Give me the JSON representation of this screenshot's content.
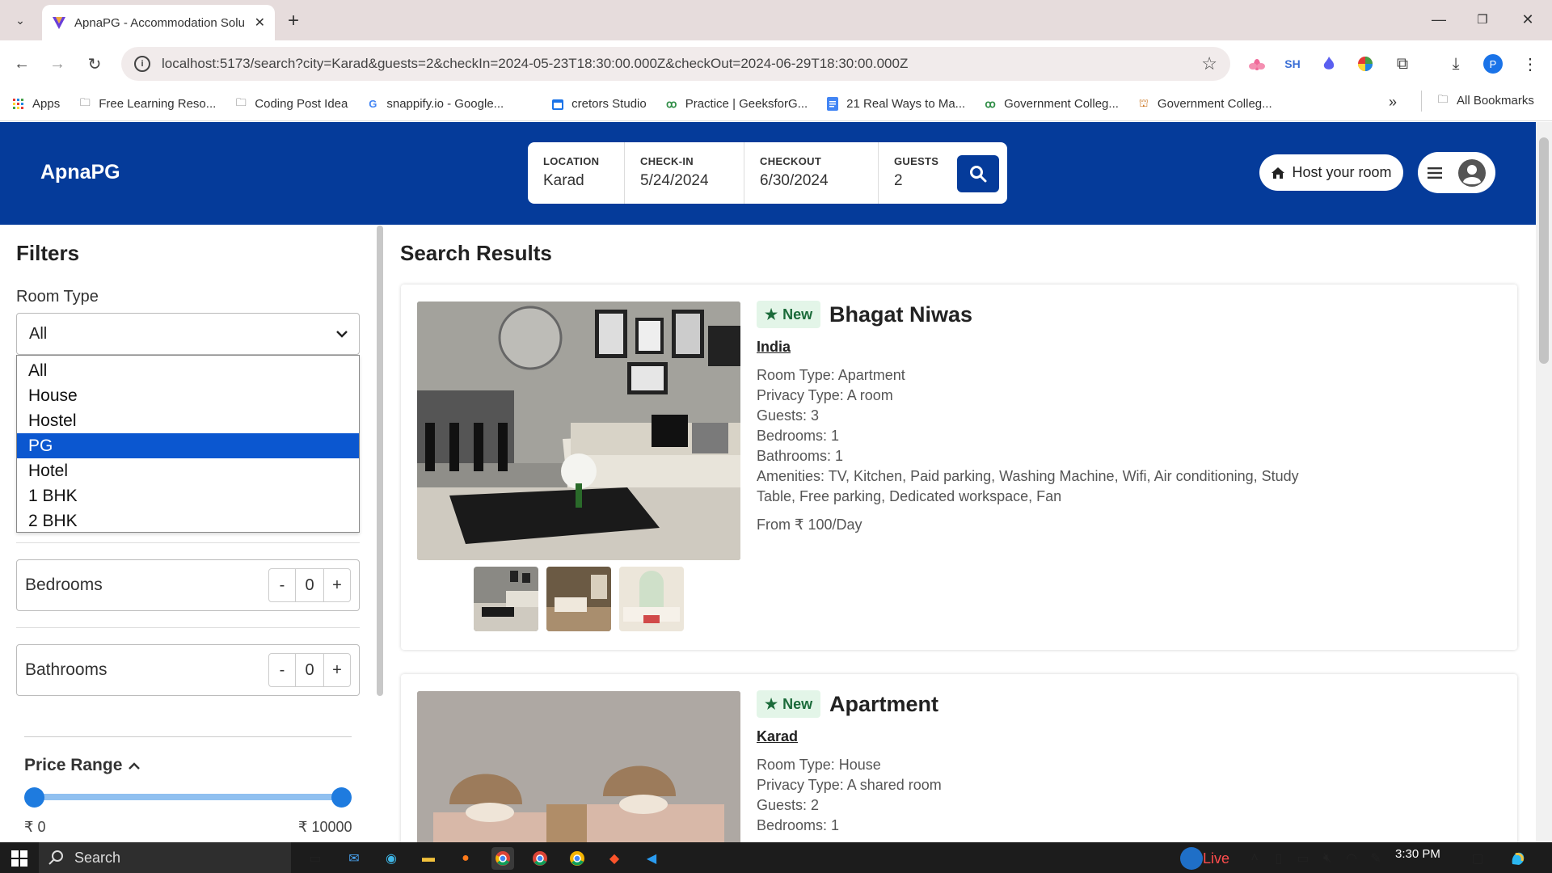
{
  "browser": {
    "tab_title": "ApnaPG - Accommodation Solu",
    "url": "localhost:5173/search?city=Karad&guests=2&checkIn=2024-05-23T18:30:00.000Z&checkOut=2024-06-29T18:30:00.000Z",
    "extensions": [
      "SH"
    ],
    "profile_initial": "P",
    "bookmarks": [
      {
        "label": "Apps",
        "icon": "apps-grid-icon"
      },
      {
        "label": "Free Learning Reso...",
        "icon": "folder-icon"
      },
      {
        "label": "Coding Post Idea",
        "icon": "folder-icon"
      },
      {
        "label": "snappify.io - Google...",
        "icon": "google-icon"
      },
      {
        "label": "cretors Studio",
        "icon": "calendar-icon"
      },
      {
        "label": "Practice | GeeksforG...",
        "icon": "gfg-icon"
      },
      {
        "label": "21 Real Ways to Ma...",
        "icon": "doc-icon"
      },
      {
        "label": "Government Colleg...",
        "icon": "gfg-icon"
      },
      {
        "label": "Government Colleg...",
        "icon": "college-icon"
      }
    ],
    "all_bookmarks": "All Bookmarks"
  },
  "app": {
    "logo": "ApnaPG",
    "search": {
      "location_label": "LOCATION",
      "location_value": "Karad",
      "checkin_label": "CHECK-IN",
      "checkin_value": "5/24/2024",
      "checkout_label": "CHECKOUT",
      "checkout_value": "6/30/2024",
      "guests_label": "GUESTS",
      "guests_value": "2"
    },
    "host_button": "Host your room"
  },
  "filters": {
    "title": "Filters",
    "room_type_label": "Room Type",
    "room_type_selected": "All",
    "room_type_options": [
      "All",
      "House",
      "Hostel",
      "PG",
      "Hotel",
      "1 BHK",
      "2 BHK"
    ],
    "highlighted_option": "PG",
    "bedrooms_label": "Bedrooms",
    "bedrooms_value": "0",
    "bathrooms_label": "Bathrooms",
    "bathrooms_value": "0",
    "minus": "-",
    "plus": "+",
    "price_range_label": "Price Range",
    "price_min": "₹ 0",
    "price_max": "₹ 10000"
  },
  "results": {
    "title": "Search Results",
    "listings": [
      {
        "badge": "New",
        "name": "Bhagat Niwas",
        "location": "India",
        "room_type": "Room Type: Apartment",
        "privacy": "Privacy Type: A room",
        "guests": "Guests: 3",
        "bedrooms": "Bedrooms: 1",
        "bathrooms": "Bathrooms: 1",
        "amenities": "Amenities: TV, Kitchen, Paid parking, Washing Machine, Wifi, Air conditioning, Study Table, Free parking, Dedicated workspace, Fan",
        "price": "From ₹ 100/Day"
      },
      {
        "badge": "New",
        "name": "Apartment",
        "location": "Karad",
        "room_type": "Room Type: House",
        "privacy": "Privacy Type: A shared room",
        "guests": "Guests: 2",
        "bedrooms": "Bedrooms: 1"
      }
    ]
  },
  "taskbar": {
    "search_placeholder": "Search",
    "live_label": "Live",
    "time": "3:30 PM"
  },
  "colors": {
    "brand": "#053b9a",
    "highlight": "#0b57d0",
    "badge_bg": "#e3f5e8",
    "slider": "#1e7bdf"
  }
}
